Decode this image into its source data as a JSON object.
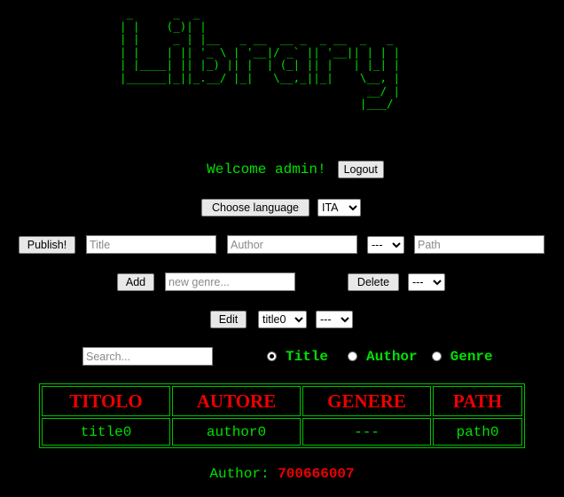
{
  "banner_ascii": " _      _  _                           \n| |    (_)| |                          \n| |     _ | |__   _ __  __ _  _ __  _   _ \n| |    | || '_ \\ | '__|/ _` || '__|| | | |\n| |____| || |_) || |  | (_| || |   | |_| |\n|______|_||_.__/ |_|   \\__,_||_|    \\__, |\n                                     __/ |\n                                    |___/ ",
  "header": {
    "welcome_text": "Welcome admin!",
    "logout_label": "Logout"
  },
  "language": {
    "button_label": "Choose language",
    "selected": "ITA"
  },
  "publish_form": {
    "publish_label": "Publish!",
    "title_placeholder": "Title",
    "author_placeholder": "Author",
    "genre_selected": "---",
    "path_placeholder": "Path"
  },
  "genre_form": {
    "add_label": "Add",
    "new_genre_placeholder": "new genre...",
    "delete_label": "Delete",
    "delete_selected": "---"
  },
  "edit_form": {
    "edit_label": "Edit",
    "title_selected": "title0",
    "field_selected": "---"
  },
  "search": {
    "placeholder": "Search...",
    "options": [
      {
        "label": "Title",
        "checked": true
      },
      {
        "label": "Author",
        "checked": false
      },
      {
        "label": "Genre",
        "checked": false
      }
    ]
  },
  "table": {
    "headers": [
      "TITOLO",
      "AUTORE",
      "GENERE",
      "PATH"
    ],
    "rows": [
      [
        "title0",
        "author0",
        "---",
        "path0"
      ]
    ]
  },
  "footer": {
    "label": "Author:",
    "value": "700666007"
  }
}
